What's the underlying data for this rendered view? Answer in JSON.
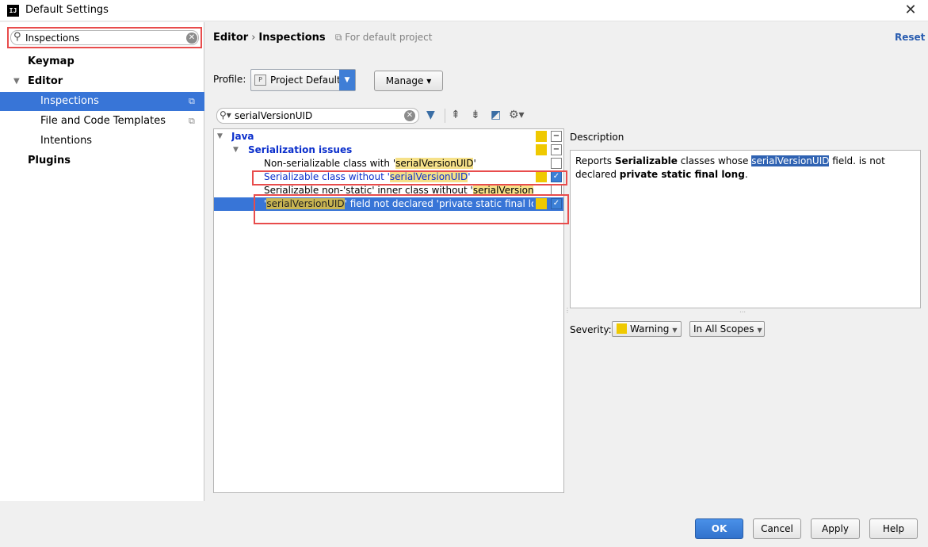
{
  "window": {
    "title": "Default Settings",
    "app_icon_text": "IJ",
    "close_glyph": "✕"
  },
  "sidebar": {
    "search": {
      "value": "Inspections",
      "placeholder": ""
    },
    "items": [
      {
        "label": "Keymap",
        "bold": true
      },
      {
        "label": "Editor",
        "bold": true,
        "expanded": true
      },
      {
        "label": "Inspections",
        "selected": true,
        "has_copy_icon": true
      },
      {
        "label": "File and Code Templates",
        "has_copy_icon": true
      },
      {
        "label": "Intentions"
      },
      {
        "label": "Plugins",
        "bold": true
      }
    ]
  },
  "header": {
    "breadcrumb": [
      "Editor",
      "Inspections"
    ],
    "breadcrumb_sep": "›",
    "for_default": "For default project",
    "reset": "Reset"
  },
  "profile": {
    "label": "Profile:",
    "value": "Project Default",
    "manage": "Manage ▾"
  },
  "filter": {
    "value": "serialVersionUID"
  },
  "tree": [
    {
      "label_parts": [
        {
          "t": "Java"
        }
      ],
      "blue": true,
      "bold": true,
      "level": 0,
      "arrow": "▼",
      "severity": true,
      "check": "minus"
    },
    {
      "label_parts": [
        {
          "t": "Serialization issues"
        }
      ],
      "blue": true,
      "bold": true,
      "level": 1,
      "arrow": "▼",
      "severity": true,
      "check": "minus"
    },
    {
      "label_parts": [
        {
          "t": "Non-serializable class with '"
        },
        {
          "t": "serialVersionUID",
          "h": true
        },
        {
          "t": "'"
        }
      ],
      "level": 2,
      "check": "unchecked"
    },
    {
      "label_parts": [
        {
          "t": "Serializable class without '"
        },
        {
          "t": "serialVersionUID",
          "h": true
        },
        {
          "t": "'"
        }
      ],
      "blue": true,
      "level": 2,
      "severity": true,
      "check": "checked",
      "boxed": true
    },
    {
      "label_parts": [
        {
          "t": "Serializable non-'static' inner class without '"
        },
        {
          "t": "serialVersionUI",
          "h": true
        }
      ],
      "level": 2,
      "check": "unchecked"
    },
    {
      "label_parts": [
        {
          "t": "'"
        },
        {
          "t": "serialVersionUID",
          "h": true
        },
        {
          "t": "' field not declared 'private static final lor"
        }
      ],
      "level": 2,
      "severity": true,
      "check": "checked",
      "selected": true
    }
  ],
  "description": {
    "label": "Description",
    "parts": [
      {
        "t": "Reports "
      },
      {
        "t": "Serializable",
        "b": true
      },
      {
        "t": " classes whose "
      },
      {
        "t": "serialVersionUID",
        "sel": true
      },
      {
        "t": " field. is not declared "
      },
      {
        "t": "private static final long",
        "b": true
      },
      {
        "t": "."
      }
    ]
  },
  "severity": {
    "label": "Severity:",
    "value": "Warning",
    "scope": "In All Scopes"
  },
  "buttons": {
    "ok": "OK",
    "cancel": "Cancel",
    "apply": "Apply",
    "help": "Help"
  },
  "colors": {
    "accent": "#3875d7",
    "highlight": "#f6e189",
    "warning": "#efc900",
    "annotation": "#e84c4c"
  }
}
